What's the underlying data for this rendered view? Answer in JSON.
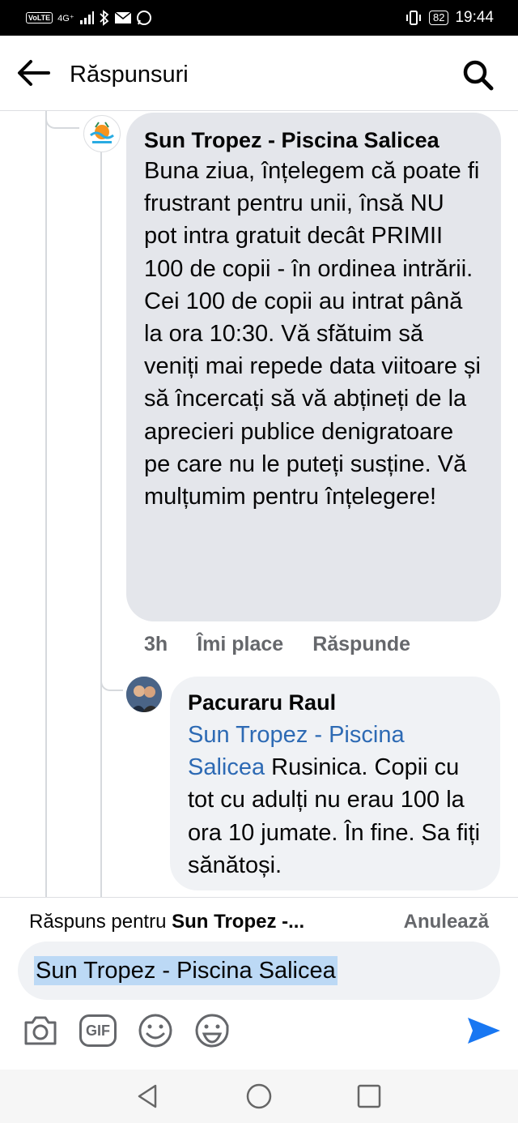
{
  "status_bar": {
    "time": "19:44",
    "battery": "82",
    "volte": "VoLTE",
    "network": "4G⁺"
  },
  "header": {
    "title": "Răspunsuri"
  },
  "comment1": {
    "author": "Sun Tropez - Piscina Salicea",
    "text": "Buna ziua, înțelegem că poate fi frustrant pentru unii, însă NU pot intra gratuit decât PRIMII 100 de copii - în ordinea intrării. Cei 100 de copii au intrat până la ora 10:30. Vă sfătuim să veniți mai repede data viitoare și să încercați să vă abțineți de la aprecieri publice denigratoare pe care nu le puteți susține. Vă mulțumim pentru înțelegere!",
    "time": "3h",
    "like_label": "Îmi place",
    "reply_label": "Răspunde"
  },
  "comment2": {
    "author": "Pacuraru Raul",
    "mention": "Sun Tropez - Piscina Salicea",
    "text": " Rusinica. Copii cu tot cu adulți nu erau 100 la ora 10 jumate. În fine. Sa fiți sănătoși."
  },
  "reply": {
    "prefix": "Răspuns pentru ",
    "target": "Sun Tropez -...",
    "cancel_label": "Anulează",
    "input_value": "Sun Tropez - Piscina Salicea"
  },
  "toolbar": {
    "icons": [
      "camera-icon",
      "gif-icon",
      "emoji-icon",
      "sticker-icon",
      "send-icon"
    ],
    "gif_label": "GIF"
  },
  "colors": {
    "mention": "#2d6ab4",
    "send": "#1877f2",
    "bubble": "#e4e6eb",
    "meta": "#65676b"
  }
}
